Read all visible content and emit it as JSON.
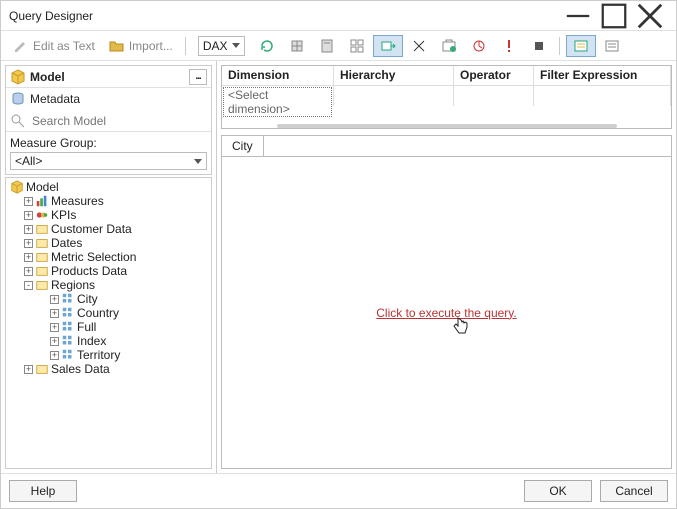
{
  "window": {
    "title": "Query Designer"
  },
  "toolbar": {
    "edit_as_text": "Edit as Text",
    "import": "Import...",
    "command_type": "DAX"
  },
  "left_panel": {
    "model_header": "Model",
    "metadata_label": "Metadata",
    "search_placeholder": "Search Model",
    "measure_group_label": "Measure Group:",
    "measure_group_value": "<All>"
  },
  "tree": {
    "root": "Model",
    "items": [
      {
        "label": "Measures",
        "icon": "measures"
      },
      {
        "label": "KPIs",
        "icon": "kpi"
      },
      {
        "label": "Customer Data",
        "icon": "folder"
      },
      {
        "label": "Dates",
        "icon": "folder"
      },
      {
        "label": "Metric Selection",
        "icon": "folder"
      },
      {
        "label": "Products Data",
        "icon": "folder"
      },
      {
        "label": "Regions",
        "icon": "folder",
        "expanded": true,
        "children": [
          {
            "label": "City"
          },
          {
            "label": "Country"
          },
          {
            "label": "Full"
          },
          {
            "label": "Index"
          },
          {
            "label": "Territory"
          }
        ]
      },
      {
        "label": "Sales Data",
        "icon": "folder"
      }
    ]
  },
  "filter": {
    "headers": {
      "dimension": "Dimension",
      "hierarchy": "Hierarchy",
      "operator": "Operator",
      "expr": "Filter Expression"
    },
    "select_dimension": "<Select dimension>"
  },
  "results": {
    "tab": "City",
    "execute_link": "Click to execute the query."
  },
  "footer": {
    "help": "Help",
    "ok": "OK",
    "cancel": "Cancel"
  }
}
